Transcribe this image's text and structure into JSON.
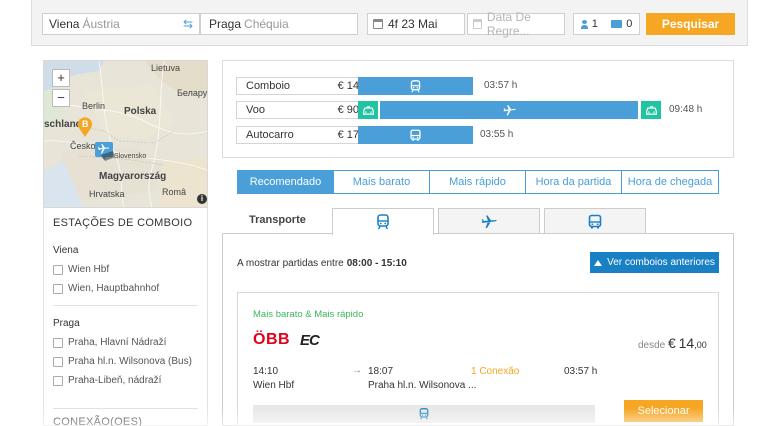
{
  "search": {
    "from_city": "Viena",
    "from_country": "Áustria",
    "to_city": "Praga",
    "to_country": "Chéquia",
    "departure_date": "4f 23 Mai",
    "return_placeholder": "Data De Regre...",
    "adults": "1",
    "cards": "0",
    "search_label": "Pesquisar"
  },
  "map": {
    "zoom_in": "+",
    "zoom_out": "−",
    "labels": [
      "Lietuva",
      "Беларус",
      "Berlin",
      "Polska",
      "schland",
      "Česko",
      "Slovensko",
      "Magyarország",
      "Hrvatska",
      "Româ"
    ],
    "marker_b": "B",
    "info": "i"
  },
  "filters": {
    "stations_title": "ESTAÇÕES DE COMBOIO",
    "groups": [
      {
        "name": "Viena",
        "items": [
          "Wien Hbf",
          "Wien, Hauptbahnhof"
        ]
      },
      {
        "name": "Praga",
        "items": [
          "Praha, Hlavní Nádraží",
          "Praha hl.n. Wilsonova (Bus)",
          "Praha-Libeň, nádraží"
        ]
      }
    ],
    "connections_title": "CONEXÃO(OES)"
  },
  "compare": [
    {
      "mode": "Comboio",
      "price": "€ 14",
      "time": "03:57 h",
      "icon": "train-icon"
    },
    {
      "mode": "Voo",
      "price": "€ 90",
      "time": "09:48 h",
      "icon": "plane-icon"
    },
    {
      "mode": "Autocarro",
      "price": "€ 17",
      "time": "03:55 h",
      "icon": "bus-icon"
    }
  ],
  "sort_tabs": [
    "Recomendado",
    "Mais barato",
    "Mais rápido",
    "Hora da partida",
    "Hora de chegada"
  ],
  "transport": {
    "label": "Transporte",
    "tabs": [
      "train-icon",
      "plane-icon",
      "bus-icon"
    ]
  },
  "results": {
    "showing_prefix": "A mostrar partidas entre",
    "showing_range": "08:00 - 15:10",
    "prev_button": "Ver comboios anteriores",
    "card": {
      "tag": "Mais barato & Mais rápido",
      "operator": "ÖBB",
      "train_type": "EC",
      "price_prefix": "desde",
      "price_currency": "€",
      "price_whole": "14",
      "price_cents": ",00",
      "dep_time": "14:10",
      "arr_time": "18:07",
      "dep_station": "Wien Hbf",
      "arr_station": "Praha hl.n. Wilsonova ...",
      "connections": "1 Conexão",
      "duration": "03:57 h",
      "select_label": "Selecionar"
    }
  },
  "colors": {
    "accent_blue": "#4a9fd8",
    "dark_blue": "#1a80c4",
    "orange": "#f5a623",
    "green_tag": "#3bb55c",
    "taxi_green": "#20c3a2",
    "obb_red": "#e2001a"
  }
}
